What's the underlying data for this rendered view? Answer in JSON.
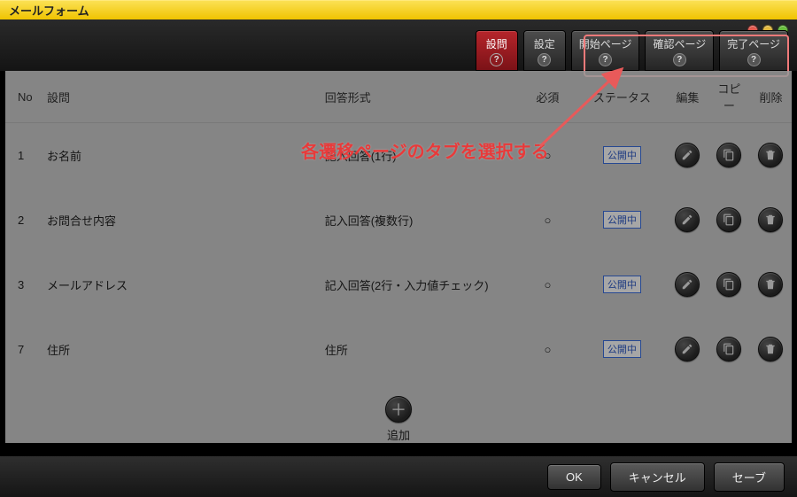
{
  "title": "メールフォーム",
  "tabs": {
    "question": "設問",
    "settings": "設定",
    "start_page": "開始ページ",
    "confirm_page": "確認ページ",
    "complete_page": "完了ページ"
  },
  "columns": {
    "no": "No",
    "question": "設問",
    "format": "回答形式",
    "required": "必須",
    "status": "ステータス",
    "edit": "編集",
    "copy": "コピー",
    "delete": "削除"
  },
  "rows": [
    {
      "no": "1",
      "question": "お名前",
      "format": "記入回答(1行)",
      "required": "○",
      "status": "公開中"
    },
    {
      "no": "2",
      "question": "お問合せ内容",
      "format": "記入回答(複数行)",
      "required": "○",
      "status": "公開中"
    },
    {
      "no": "3",
      "question": "メールアドレス",
      "format": "記入回答(2行・入力値チェック)",
      "required": "○",
      "status": "公開中"
    },
    {
      "no": "7",
      "question": "住所",
      "format": "住所",
      "required": "○",
      "status": "公開中"
    }
  ],
  "add_label": "追加",
  "footer": {
    "ok": "OK",
    "cancel": "キャンセル",
    "save": "セーブ"
  },
  "annotation": "各遷移ページのタブを選択する"
}
